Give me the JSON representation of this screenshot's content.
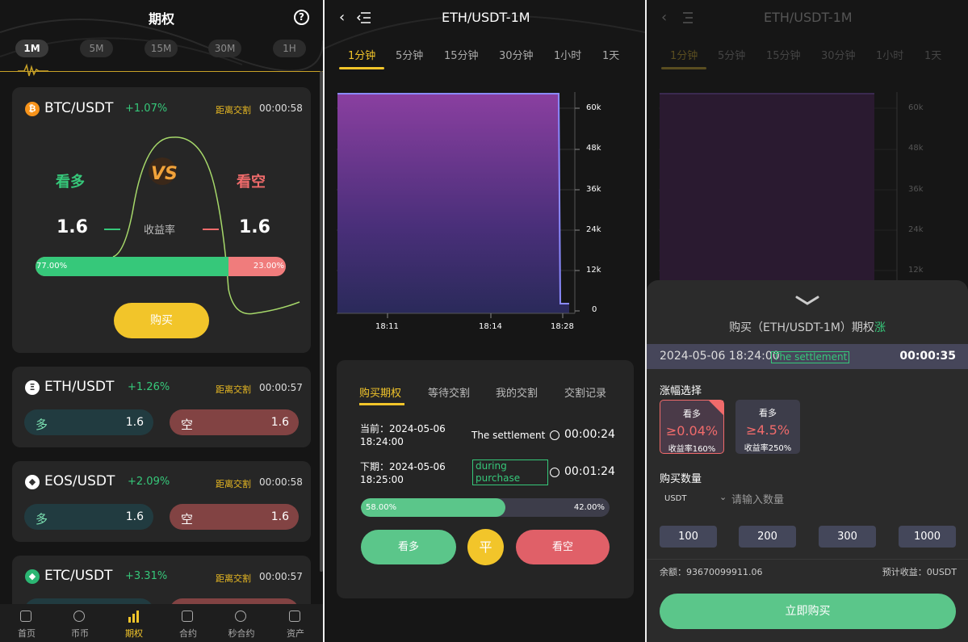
{
  "panel1": {
    "title": "期权",
    "help_icon": "?",
    "timeframes": [
      "1M",
      "5M",
      "15M",
      "30M",
      "1H"
    ],
    "main_card": {
      "coin_icon": "₿",
      "pair": "BTC/USDT",
      "change": "+1.07%",
      "distance_label": "距离交割",
      "distance_time": "00:00:58",
      "up_label": "看多",
      "down_label": "看空",
      "up_rate": "1.6",
      "down_rate": "1.6",
      "rate_label": "收益率",
      "up_ratio_text": "77.00%",
      "down_ratio_text": "23.00%",
      "up_ratio": 0.77,
      "buy_label": "购买"
    },
    "cards": [
      {
        "coin_icon": "Ξ",
        "pair": "ETH/USDT",
        "change": "+1.26%",
        "distance_label": "距离交割",
        "distance_time": "00:00:57",
        "up_label": "多",
        "up_rate": "1.6",
        "down_label": "空",
        "down_rate": "1.6"
      },
      {
        "coin_icon": "◆",
        "pair": "EOS/USDT",
        "change": "+2.09%",
        "distance_label": "距离交割",
        "distance_time": "00:00:58",
        "up_label": "多",
        "up_rate": "1.6",
        "down_label": "空",
        "down_rate": "1.6"
      },
      {
        "coin_icon": "◆",
        "pair": "ETC/USDT",
        "change": "+3.31%",
        "distance_label": "距离交割",
        "distance_time": "00:00:57"
      }
    ],
    "nav": [
      "首页",
      "币币",
      "期权",
      "合约",
      "秒合约",
      "资产"
    ],
    "nav_active": 2
  },
  "panel2": {
    "title": "ETH/USDT-1M",
    "time_tabs": [
      "1分钟",
      "5分钟",
      "15分钟",
      "30分钟",
      "1小时",
      "1天"
    ],
    "active_time_tab": 0,
    "y_ticks": [
      "60k",
      "48k",
      "36k",
      "24k",
      "12k",
      "0"
    ],
    "x_ticks": [
      "18:11",
      "18:14",
      "18:28"
    ],
    "sub_tabs": [
      "购买期权",
      "等待交割",
      "我的交割",
      "交割记录"
    ],
    "current_label": "当前：2024-05-06",
    "current_time": "18:24:00",
    "current_status": "The settlement",
    "current_countdown": "00:00:24",
    "next_label": "下期：2024-05-06",
    "next_time": "18:25:00",
    "next_status": "during purchase",
    "next_countdown": "00:01:24",
    "up_ratio_text": "58.00%",
    "down_ratio_text": "42.00%",
    "up_ratio": 0.58,
    "btn_up": "看多",
    "btn_flat": "平",
    "btn_down": "看空"
  },
  "panel3": {
    "title": "ETH/USDT-1M",
    "time_tabs": [
      "1分钟",
      "5分钟",
      "15分钟",
      "30分钟",
      "1小时",
      "1天"
    ],
    "y_ticks": [
      "60k",
      "48k",
      "36k",
      "24k",
      "12k"
    ],
    "sheet_title_prefix": "购买（ETH/USDT-1M）期权",
    "sheet_title_highlight": "涨",
    "cur_date": "2024-05-06 18:24:00",
    "cur_badge": "The settlement",
    "cur_countdown": "00:00:35",
    "range_label": "涨幅选择",
    "options": [
      {
        "dir": "看多",
        "range": "≥0.04%",
        "rate": "收益率160%"
      },
      {
        "dir": "看多",
        "range": "≥4.5%",
        "rate": "收益率250%"
      }
    ],
    "qty_label": "购买数量",
    "currency": "USDT",
    "qty_placeholder": "请输入数量",
    "amounts": [
      "100",
      "200",
      "300",
      "1000"
    ],
    "balance": "余额：93670099911.06",
    "expected": "预计收益：0USDT",
    "buy_now": "立即购买"
  }
}
